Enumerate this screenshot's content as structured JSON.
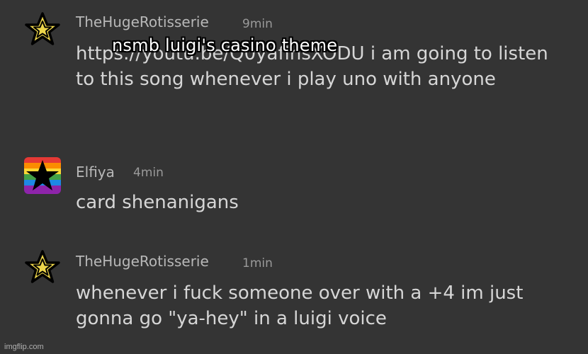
{
  "colors": {
    "background": "#343434",
    "author": "#b8b8b8",
    "timestamp": "#9a9a9a",
    "message": "#d6d6d6",
    "star_gold": "#ecd54a",
    "avatar_border": "#000000"
  },
  "caption": "nsmb luigi's casino theme",
  "messages": [
    {
      "author": "TheHugeRotisserie",
      "time": "9min",
      "avatar_icon": "gold-star-icon",
      "text": "https://youtu.be/Q0yaflnsXODU i am going to listen to this song whenever i play uno with anyone"
    },
    {
      "author": "Elfiya",
      "time": "4min",
      "avatar_icon": "rainbow-star-icon",
      "text": "card shenanigans"
    },
    {
      "author": "TheHugeRotisserie",
      "time": "1min",
      "avatar_icon": "gold-star-icon",
      "text": "whenever i fuck someone over with a +4 im just gonna go \"ya-hey\" in a luigi voice"
    }
  ],
  "watermark": "imgflip.com"
}
